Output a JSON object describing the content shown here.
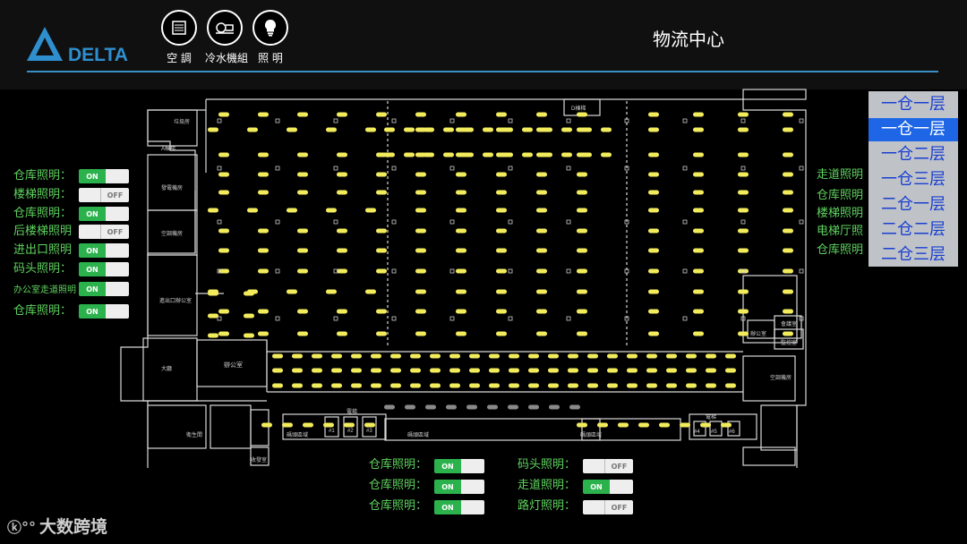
{
  "brand": {
    "name": "DELTA"
  },
  "page_title": "物流中心",
  "header_buttons": [
    {
      "label": "空 調",
      "icon": "ac-icon"
    },
    {
      "label": "冷水機組",
      "icon": "chiller-icon"
    },
    {
      "label": "照 明",
      "icon": "lightbulb-icon"
    }
  ],
  "left_switches": [
    {
      "label": "仓库照明：",
      "state": "ON"
    },
    {
      "label": "楼梯照明：",
      "state": "OFF"
    },
    {
      "label": "仓库照明：",
      "state": "ON"
    },
    {
      "label": "后楼梯照明",
      "state": "OFF"
    },
    {
      "label": "进出口照明",
      "state": "ON"
    },
    {
      "label": "码头照明：",
      "state": "ON"
    },
    {
      "label": "办公室走道照明",
      "state": "ON"
    },
    {
      "label": "仓库照明：",
      "state": "ON"
    }
  ],
  "bottom_switches": [
    {
      "label": "仓库照明：",
      "state": "ON"
    },
    {
      "label": "仓库照明：",
      "state": "ON"
    },
    {
      "label": "仓库照明：",
      "state": "ON"
    },
    {
      "label": "码头照明：",
      "state": "OFF"
    },
    {
      "label": "走道照明：",
      "state": "ON"
    },
    {
      "label": "路灯照明：",
      "state": "OFF"
    }
  ],
  "right_labels": [
    "走道照明",
    "仓库照明",
    "楼梯照明",
    "电梯厅照",
    "仓库照明"
  ],
  "floor_menu": {
    "items": [
      "一仓一层",
      "一仓一层",
      "一仓二层",
      "一仓三层",
      "二仓一层",
      "二仓二层",
      "二仓三层"
    ],
    "selected_index": 1
  },
  "floor_plan": {
    "rooms": [
      "垃圾房",
      "A棟梯",
      "D棟梯",
      "發電機房",
      "空調機房",
      "進出口辦公室",
      "大廳",
      "辦公室",
      "電梯",
      "電梯",
      "碼頭區域",
      "碼頭區域",
      "碼頭區域",
      "會議室",
      "監控室",
      "辦公室",
      "空調機房",
      "#1",
      "#2",
      "#3",
      "#4",
      "#5",
      "#6",
      "收發室",
      "衛生間"
    ]
  },
  "colors": {
    "light_on": "#f2ec5c",
    "light_off": "#8a8a8a",
    "switch_on": "#2bb24c",
    "label": "#5fd35f",
    "accent_line": "#3a8fc7",
    "menu_selected": "#1e66e6"
  },
  "watermark": "大数跨境"
}
